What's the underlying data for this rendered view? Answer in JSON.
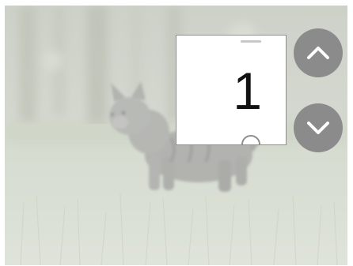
{
  "page_indicator": {
    "value": "1"
  },
  "controls": {
    "up_icon": "chevron-up-icon",
    "down_icon": "chevron-down-icon",
    "button_color": "#8b8b8b"
  },
  "background": {
    "subject": "kitten-in-grass"
  }
}
